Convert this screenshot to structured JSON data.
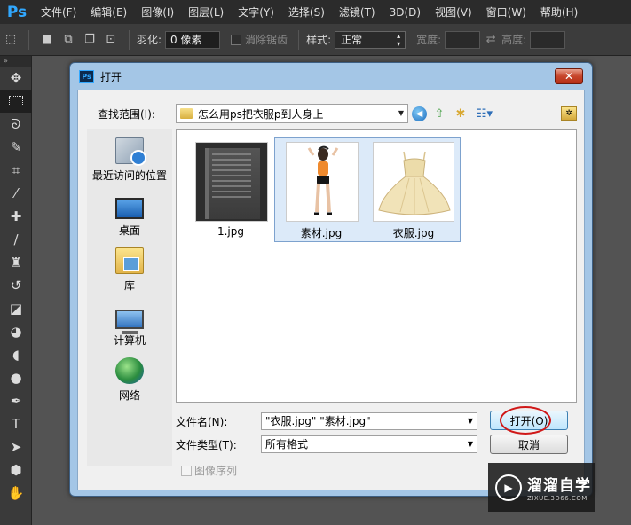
{
  "app": {
    "logo": "Ps",
    "menu": [
      "文件(F)",
      "编辑(E)",
      "图像(I)",
      "图层(L)",
      "文字(Y)",
      "选择(S)",
      "滤镜(T)",
      "3D(D)",
      "视图(V)",
      "窗口(W)",
      "帮助(H)"
    ]
  },
  "options": {
    "feather_label": "羽化:",
    "feather_value": "0 像素",
    "antialias_label": "消除锯齿",
    "style_label": "样式:",
    "style_value": "正常",
    "width_label": "宽度:",
    "height_label": "高度:"
  },
  "dialog": {
    "title": "打开",
    "close_glyph": "✕",
    "lookin_label": "查找范围(I):",
    "lookin_value": "怎么用ps把衣服p到人身上",
    "places": [
      {
        "label": "最近访问的位置",
        "icon": "recent-places-icon"
      },
      {
        "label": "桌面",
        "icon": "desktop-icon"
      },
      {
        "label": "库",
        "icon": "library-icon"
      },
      {
        "label": "计算机",
        "icon": "computer-icon"
      },
      {
        "label": "网络",
        "icon": "network-icon"
      }
    ],
    "files": [
      {
        "name": "1.jpg",
        "selected": false
      },
      {
        "name": "素材.jpg",
        "selected": true
      },
      {
        "name": "衣服.jpg",
        "selected": true
      }
    ],
    "filename_label": "文件名(N):",
    "filename_value": "\"衣服.jpg\" \"素材.jpg\"",
    "filetype_label": "文件类型(T):",
    "filetype_value": "所有格式",
    "open_button": "打开(O)",
    "cancel_button": "取消",
    "sequence_label": "图像序列"
  },
  "watermark": {
    "brand": "溜溜自学",
    "url": "ZIXUE.3D66.COM"
  },
  "colors": {
    "ps_blue": "#31a8ff",
    "dialog_frame": "#a4c6e6",
    "selection": "#dceaf9",
    "highlight_ring": "#d01818"
  }
}
